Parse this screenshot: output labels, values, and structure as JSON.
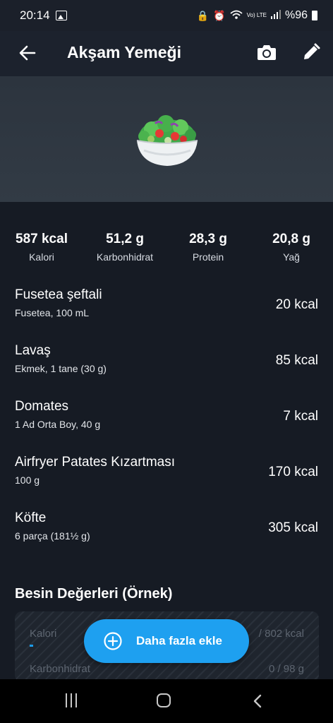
{
  "status": {
    "time": "20:14",
    "network": "Vo) LTE",
    "battery": "%96"
  },
  "header": {
    "title": "Akşam Yemeği"
  },
  "macros": [
    {
      "value": "587 kcal",
      "label": "Kalori"
    },
    {
      "value": "51,2 g",
      "label": "Karbonhidrat"
    },
    {
      "value": "28,3 g",
      "label": "Protein"
    },
    {
      "value": "20,8 g",
      "label": "Yağ"
    }
  ],
  "foods": [
    {
      "name": "Fusetea  şeftali",
      "desc": "Fusetea, 100 mL",
      "kcal": "20 kcal"
    },
    {
      "name": "Lavaş",
      "desc": "Ekmek, 1 tane (30 g)",
      "kcal": "85 kcal"
    },
    {
      "name": "Domates",
      "desc": "1 Ad Orta Boy, 40 g",
      "kcal": "7 kcal"
    },
    {
      "name": "Airfryer Patates Kızartması",
      "desc": "100 g",
      "kcal": "170 kcal"
    },
    {
      "name": "Köfte",
      "desc": "6 parça (181½ g)",
      "kcal": "305 kcal"
    }
  ],
  "nutrition": {
    "title": "Besin Değerleri (Örnek)",
    "rows": [
      {
        "label": "Kalori",
        "value": "/ 802 kcal"
      },
      {
        "label": "Karbonhidrat",
        "value": "0 / 98 g"
      }
    ]
  },
  "fab": {
    "label": "Daha fazla ekle"
  },
  "colors": {
    "background": "#161b24",
    "accent": "#1ea0f0"
  }
}
